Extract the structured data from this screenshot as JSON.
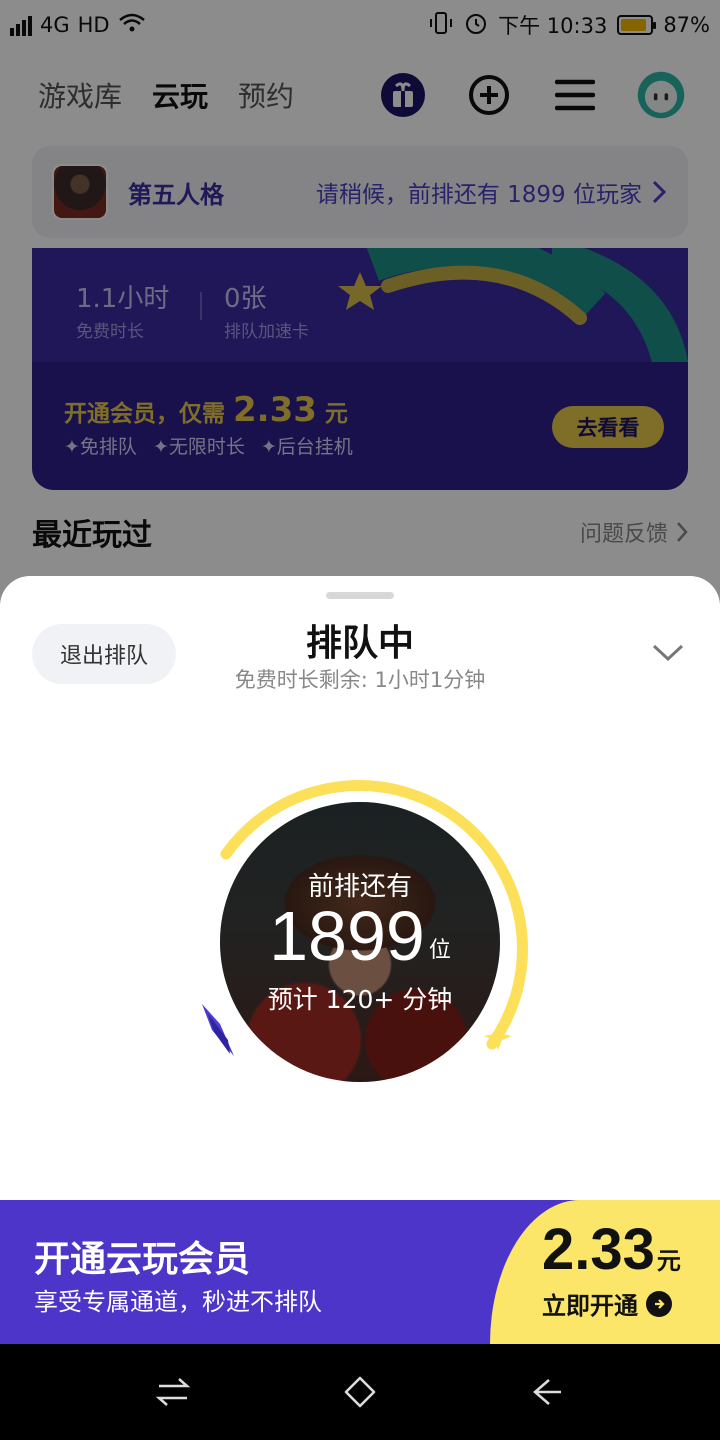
{
  "status_bar": {
    "network": "4G",
    "hd": "HD",
    "time": "下午 10:33",
    "battery": "87%",
    "battery_level": 0.87
  },
  "top_nav": {
    "tabs": [
      {
        "label": "游戏库"
      },
      {
        "label": "云玩"
      },
      {
        "label": "预约"
      }
    ],
    "active_tab": "云玩",
    "icons": [
      "gift-icon",
      "add-circle-icon",
      "menu-icon",
      "avatar-icon"
    ]
  },
  "queue_card": {
    "game": "第五人格",
    "status": "请稍候，前排还有 1899 位玩家"
  },
  "promo": {
    "free_time_value": "1.1小时",
    "free_time_label": "免费时长",
    "cards_value": "0张",
    "cards_label": "排队加速卡",
    "title_prefix": "开通会员，仅需",
    "price": "2.33",
    "price_unit": "元",
    "features": [
      "免排队",
      "无限时长",
      "后台挂机"
    ],
    "button": "去看看"
  },
  "recent": {
    "title": "最近玩过",
    "feedback": "问题反馈"
  },
  "sheet": {
    "exit_button": "退出排队",
    "title": "排队中",
    "subtitle": "免费时长剩余: 1小时1分钟",
    "ahead_label": "前排还有",
    "ahead_count": "1899",
    "ahead_unit": "位",
    "eta": "预计 120+ 分钟",
    "colors": {
      "ring": "#fde05a",
      "spark": "#4b3ccf"
    }
  },
  "member_bar": {
    "title": "开通云玩会员",
    "subtitle": "享受专属通道，秒进不排队",
    "price": "2.33",
    "price_unit": "元",
    "action": "立即开通",
    "colors": {
      "bar": "#4e35c9",
      "cta": "#fce66a"
    }
  }
}
